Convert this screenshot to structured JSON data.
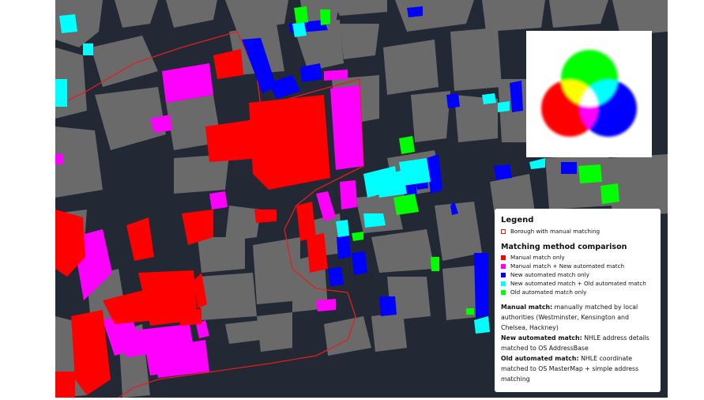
{
  "colors": {
    "background": "#222834",
    "building": "#6a6a6a",
    "boundary": "#e02020",
    "manual_only": "#ff0000",
    "manual_new": "#ff00ff",
    "new_only": "#0000ff",
    "new_old": "#00ffff",
    "old_only": "#00ff00"
  },
  "legend": {
    "title": "Legend",
    "boundary_label": "Borough with manual matching",
    "comparison_title": "Matching method comparison",
    "items": [
      {
        "label": "Manual match only",
        "color": "#ff0000"
      },
      {
        "label": "Manual match + New automated match",
        "color": "#ff00ff"
      },
      {
        "label": "New automated match only",
        "color": "#0000ff"
      },
      {
        "label": "New automated match + Old automated match",
        "color": "#00ffff"
      },
      {
        "label": "Old automated match only",
        "color": "#00ff00"
      }
    ],
    "notes": [
      {
        "term": "Manual match:",
        "text": " manually matched by local authorities (Westminster, Kensington and Chelsea, Hackney)"
      },
      {
        "term": "New automated match:",
        "text": " NHLE address details matched to OS AddressBase"
      },
      {
        "term": "Old automated match:",
        "text": " NHLE coordinate matched to OS MasterMap + simple address matching"
      }
    ]
  },
  "venn": {
    "circles": [
      {
        "name": "green",
        "color": "#00ff00"
      },
      {
        "name": "red",
        "color": "#ff0000"
      },
      {
        "name": "blue",
        "color": "#0000ff"
      }
    ]
  }
}
